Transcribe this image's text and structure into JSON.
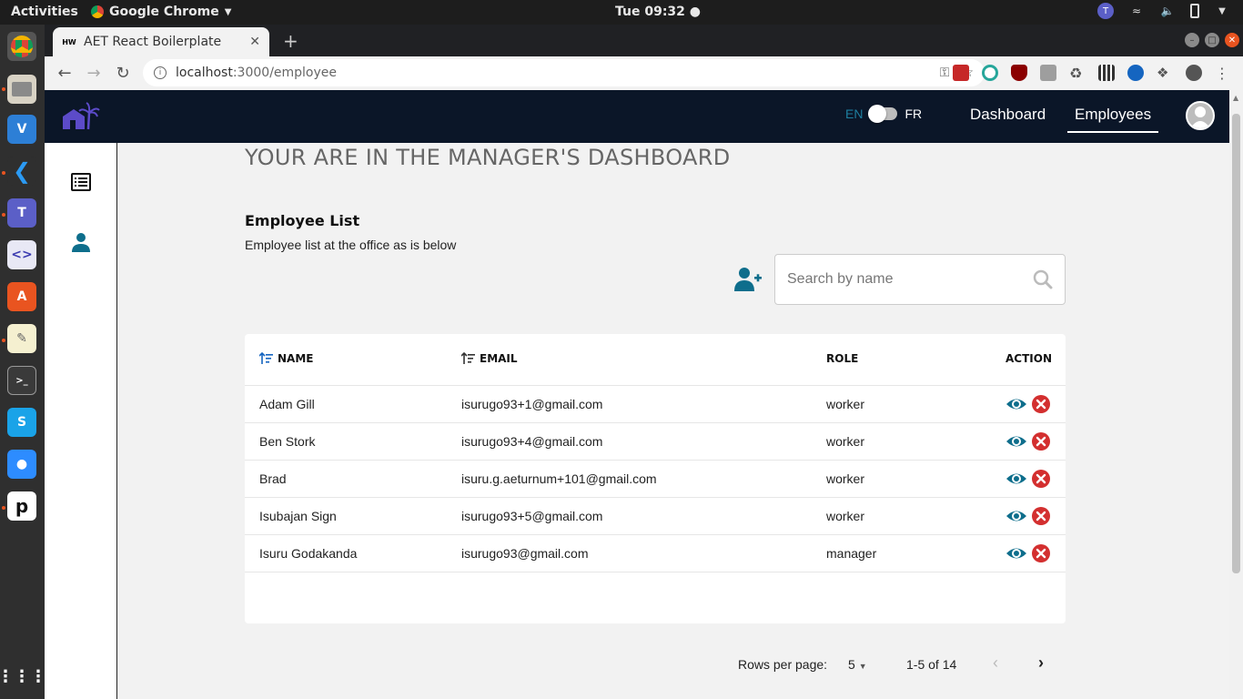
{
  "os": {
    "activities": "Activities",
    "app_name": "Google Chrome",
    "clock": "Tue 09:32"
  },
  "browser": {
    "tab_title": "AET React Boilerplate",
    "tab_favicon_text": "HW",
    "url_host": "localhost",
    "url_path": ":3000/employee"
  },
  "header": {
    "lang_en": "EN",
    "lang_fr": "FR",
    "nav": [
      "Dashboard",
      "Employees"
    ],
    "active_nav": "Employees"
  },
  "page": {
    "title": "YOUR ARE IN THE MANAGER'S DASHBOARD",
    "subtitle": "Employee List",
    "description": "Employee list at the office as is below",
    "search_placeholder": "Search by name"
  },
  "table": {
    "columns": [
      "NAME",
      "EMAIL",
      "ROLE",
      "ACTION"
    ],
    "rows": [
      {
        "name": "Adam Gill",
        "email": "isurugo93+1@gmail.com",
        "role": "worker"
      },
      {
        "name": "Ben Stork",
        "email": "isurugo93+4@gmail.com",
        "role": "worker"
      },
      {
        "name": "Brad",
        "email": "isuru.g.aeturnum+101@gmail.com",
        "role": "worker"
      },
      {
        "name": "Isubajan Sign",
        "email": "isurugo93+5@gmail.com",
        "role": "worker"
      },
      {
        "name": "Isuru Godakanda",
        "email": "isurugo93@gmail.com",
        "role": "manager"
      }
    ]
  },
  "pagination": {
    "rows_per_page_label": "Rows per page:",
    "rows_per_page": "5",
    "range": "1-5 of 14"
  },
  "colors": {
    "header_bg": "#0b1628",
    "accent": "#0e6e8c",
    "delete": "#d32f2f"
  }
}
